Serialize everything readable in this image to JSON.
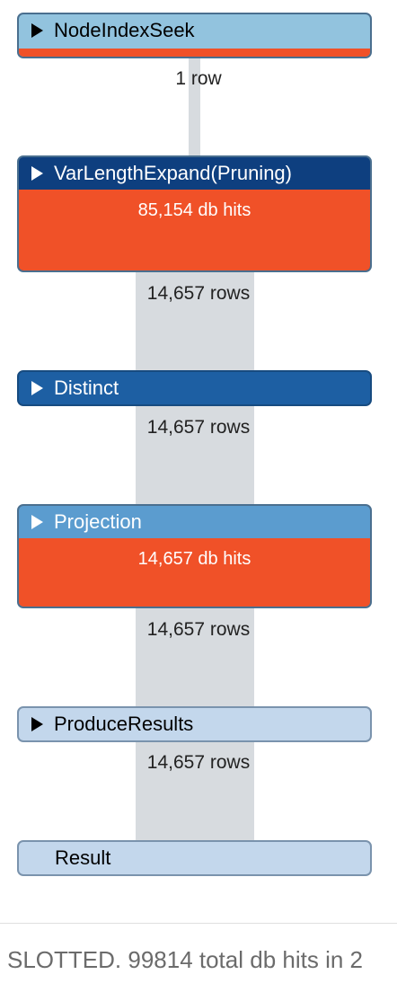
{
  "operators": [
    {
      "name": "NodeIndexSeek"
    },
    {
      "name": "VarLengthExpand(Pruning)",
      "db_hits": "85,154 db hits"
    },
    {
      "name": "Distinct"
    },
    {
      "name": "Projection",
      "db_hits": "14,657 db hits"
    },
    {
      "name": "ProduceResults"
    },
    {
      "name": "Result"
    }
  ],
  "row_labels": [
    "1 row",
    "14,657 rows",
    "14,657 rows",
    "14,657 rows",
    "14,657 rows"
  ],
  "footer": "SLOTTED. 99814 total db hits in 2",
  "colors": {
    "light_header": "#92c3de",
    "dark_header": "#0e3f7f",
    "mid_header": "#1d5fa3",
    "projection_header": "#5b9ccf",
    "pale_header": "#c3d7ec",
    "db_hits": "#f05128",
    "pipe": "#d7dbdf"
  }
}
